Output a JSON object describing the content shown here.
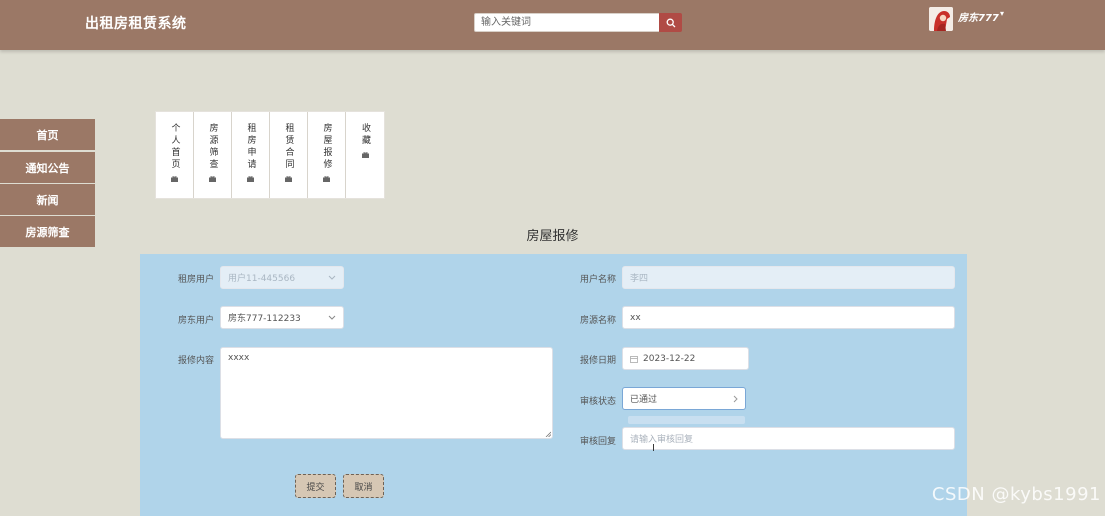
{
  "header": {
    "app_title": "出租房租赁系统",
    "search_placeholder": "输入关键词",
    "user_name": "房东777",
    "user_caret": "▾"
  },
  "sidebar": {
    "items": [
      {
        "label": "首页"
      },
      {
        "label": "通知公告"
      },
      {
        "label": "新闻"
      },
      {
        "label": "房源筛查"
      }
    ]
  },
  "tabs": [
    {
      "label": "个人首页"
    },
    {
      "label": "房源筛查"
    },
    {
      "label": "租房申请"
    },
    {
      "label": "租赁合同"
    },
    {
      "label": "房屋报修"
    },
    {
      "label": "收藏"
    }
  ],
  "page_title": "房屋报修",
  "form": {
    "renter_user": {
      "label": "租房用户",
      "value": "用户11-445566"
    },
    "landlord_user": {
      "label": "房东用户",
      "value": "房东777-112233"
    },
    "repair_content": {
      "label": "报修内容",
      "value": "xxxx"
    },
    "user_name": {
      "label": "用户名称",
      "value": "李四"
    },
    "house_name": {
      "label": "房源名称",
      "value": "xx"
    },
    "repair_date": {
      "label": "报修日期",
      "value": "2023-12-22"
    },
    "audit_status": {
      "label": "审核状态",
      "value": "已通过"
    },
    "audit_reply": {
      "label": "审核回复",
      "placeholder": "请输入审核回复"
    },
    "submit_label": "提交",
    "cancel_label": "取消"
  },
  "watermark": "CSDN @kybs1991",
  "colors": {
    "header_bg": "#9b7866",
    "page_bg": "#deddd2",
    "panel_bg": "#b0d4ea",
    "search_btn": "#b04b45",
    "button_bg": "#d6c7b4"
  }
}
